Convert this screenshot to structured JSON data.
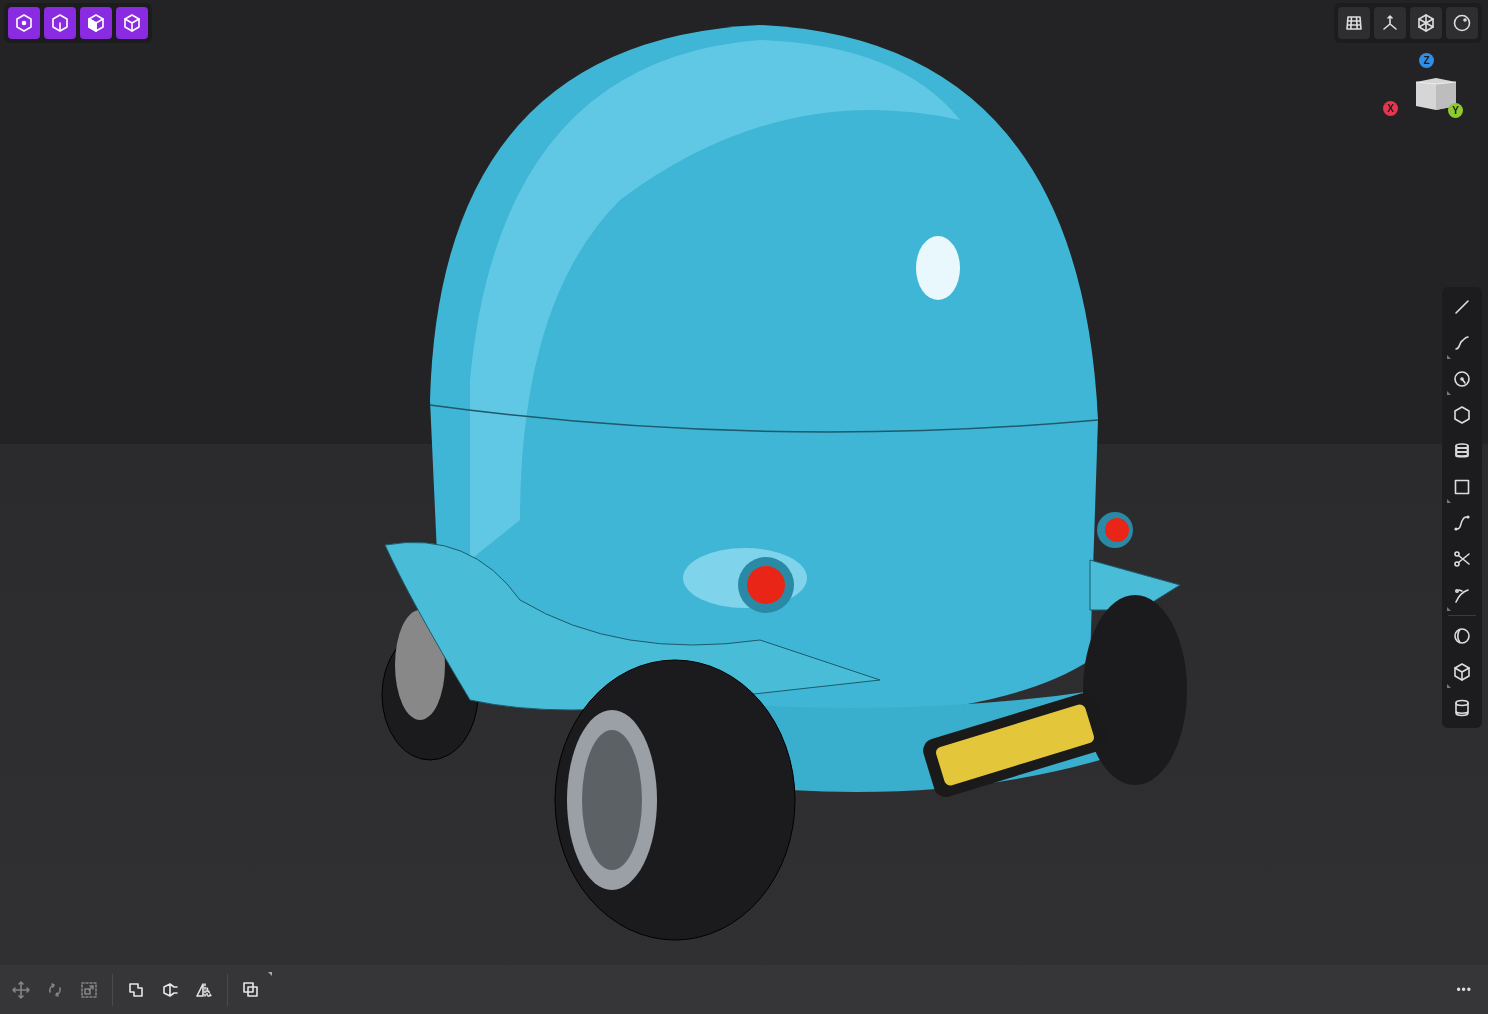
{
  "view_cube": {
    "axes": [
      {
        "kind": "z",
        "label": "Z",
        "color": "#2f8fe8"
      },
      {
        "kind": "x",
        "label": "X",
        "color": "#e8344e"
      },
      {
        "kind": "y",
        "label": "Y",
        "color": "#8ec92e"
      }
    ]
  },
  "bottom_toolbar": {
    "tools": [
      {
        "kind": "move",
        "disabled": true
      },
      {
        "kind": "rotate",
        "disabled": true
      },
      {
        "kind": "scale",
        "disabled": true
      },
      {
        "kind": "union",
        "disabled": false
      },
      {
        "kind": "extrude",
        "disabled": false
      },
      {
        "kind": "mirror",
        "disabled": false
      },
      {
        "kind": "duplicate",
        "disabled": false
      }
    ],
    "more": "•••"
  }
}
